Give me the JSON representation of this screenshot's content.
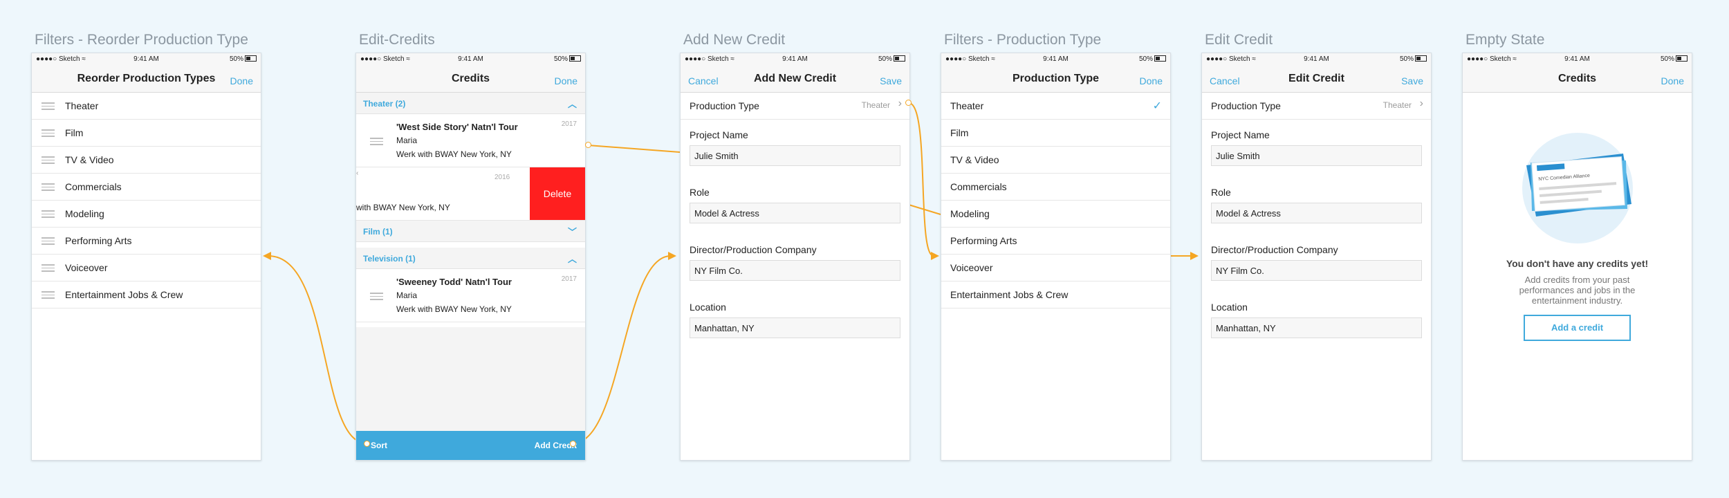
{
  "titles": [
    "Filters - Reorder Production Type",
    "Edit-Credits",
    "Add New Credit",
    "Filters - Production Type",
    "Edit Credit",
    "Empty State"
  ],
  "status": {
    "carrier": "●●●●○ Sketch ≈",
    "time": "9:41 AM",
    "battery": "50%"
  },
  "reorder": {
    "nav_title": "Reorder Production Types",
    "right": "Done",
    "items": [
      "Theater",
      "Film",
      "TV & Video",
      "Commercials",
      "Modeling",
      "Performing Arts",
      "Voiceover",
      "Entertainment Jobs & Crew"
    ]
  },
  "edit_credits": {
    "nav_title": "Credits",
    "right": "Done",
    "section_theater": "Theater (2)",
    "section_film": "Film (1)",
    "section_tv": "Television (1)",
    "credit1": {
      "title": "'West Side Story' Natn'l Tour",
      "role": "Maria",
      "company": "Werk with BWAY New York, NY",
      "year": "2017"
    },
    "credit2": {
      "company": "with BWAY New York, NY",
      "year": "2016",
      "delete": "Delete"
    },
    "credit3": {
      "title": "'Sweeney Todd' Natn'l Tour",
      "role": "Maria",
      "company": "Werk with BWAY New York, NY",
      "year": "2017"
    },
    "sort": "Sort",
    "add": "Add Credit"
  },
  "add_credit": {
    "left": "Cancel",
    "nav_title": "Add New Credit",
    "right": "Save",
    "production_type_label": "Production Type",
    "production_type_value": "Theater",
    "fields": [
      {
        "label": "Project Name",
        "value": "Julie Smith"
      },
      {
        "label": "Role",
        "value": "Model & Actress"
      },
      {
        "label": "Director/Production Company",
        "value": "NY Film Co."
      },
      {
        "label": "Location",
        "value": "Manhattan, NY"
      }
    ]
  },
  "prod_type": {
    "nav_title": "Production Type",
    "right": "Done",
    "items": [
      "Theater",
      "Film",
      "TV & Video",
      "Commercials",
      "Modeling",
      "Performing Arts",
      "Voiceover",
      "Entertainment Jobs & Crew"
    ]
  },
  "edit_credit": {
    "left": "Cancel",
    "nav_title": "Edit Credit",
    "right": "Save",
    "production_type_label": "Production Type",
    "production_type_value": "Theater",
    "fields": [
      {
        "label": "Project Name",
        "value": "Julie Smith"
      },
      {
        "label": "Role",
        "value": "Model & Actress"
      },
      {
        "label": "Director/Production Company",
        "value": "NY Film Co."
      },
      {
        "label": "Location",
        "value": "Manhattan, NY"
      }
    ]
  },
  "empty": {
    "nav_title": "Credits",
    "right": "Done",
    "card_label": "NYC Comedian Alliance",
    "headline": "You don't have any credits yet!",
    "body": "Add credits from your past performances and jobs in the entertainment industry.",
    "button": "Add a credit"
  },
  "colors": {
    "accent": "#3fa9dc",
    "connector": "#f5a623",
    "delete": "#ff1f1f"
  }
}
